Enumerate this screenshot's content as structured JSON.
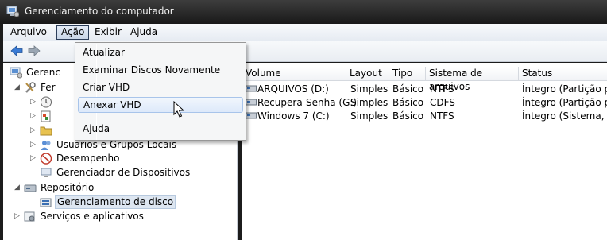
{
  "window": {
    "title": "Gerenciamento do computador",
    "icon": "computer-management-icon"
  },
  "menubar": {
    "items": [
      "Arquivo",
      "Ação",
      "Exibir",
      "Ajuda"
    ],
    "active_index": 1
  },
  "toolbar": {
    "buttons": [
      "back-arrow-icon",
      "forward-arrow-icon"
    ]
  },
  "dropdown": {
    "items": [
      "Atualizar",
      "Examinar Discos Novamente",
      "Criar VHD",
      "Anexar VHD",
      "Ajuda"
    ],
    "hover_index": 3
  },
  "tree": {
    "root": "Gerenciamento do computador (Local)",
    "root_visible": "Gerenc",
    "system_tools": "Ferramentas do Sistema",
    "system_tools_visible": "Fer",
    "local_users": "Usuários e Grupos Locais",
    "performance": "Desempenho",
    "device_manager": "Gerenciador de Dispositivos",
    "storage": "Repositório",
    "disk_management": "Gerenciamento de disco",
    "services": "Serviços e aplicativos"
  },
  "list": {
    "columns": [
      "Volume",
      "Layout",
      "Tipo",
      "Sistema de arquivos",
      "Status"
    ],
    "rows": [
      {
        "volume": "ARQUIVOS (D:)",
        "layout": "Simples",
        "tipo": "Básico",
        "fs": "NTFS",
        "status": "Íntegro (Partição prim"
      },
      {
        "volume": "Recupera-Senha (G:)",
        "layout": "Simples",
        "tipo": "Básico",
        "fs": "CDFS",
        "status": "Íntegro (Partição prim"
      },
      {
        "volume": "Windows 7 (C:)",
        "layout": "Simples",
        "tipo": "Básico",
        "fs": "NTFS",
        "status": "Íntegro (Sistema, Inici"
      }
    ]
  }
}
